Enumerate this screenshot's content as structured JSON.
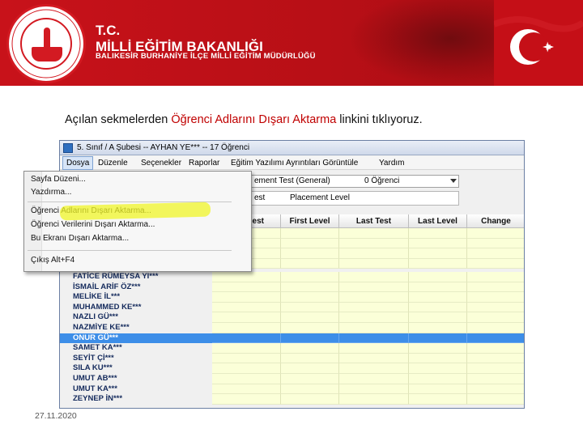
{
  "banner": {
    "title_line1": "T.C.",
    "title_line2": "MİLLİ EĞİTİM BAKANLIĞI",
    "subtitle": "BALIKESİR  BURHANİYE İLÇE MİLLİ EĞİTİM MÜDÜRLÜĞÜ",
    "seal_text": "T.C. MİLLİ EĞİTİM BAKANLIĞI",
    "colors": {
      "brand_red": "#c8121a"
    }
  },
  "instruction": {
    "before": "Açılan sekmelerden ",
    "link": "Öğrenci Adlarını Dışarı Aktarma",
    "after": " linkini tıklıyoruz."
  },
  "app": {
    "window_title": "5. Sınıf / A Şubesi -- AYHAN YE*** -- 17 Öğrenci",
    "menu": [
      "Dosya",
      "Düzenle",
      "Seçenekler",
      "Raporlar",
      "Eğitim Yazılımı Ayrıntıları Görüntüle",
      "Yardım"
    ],
    "combo": {
      "left": "ement Test (General)",
      "right": "0 Öğrenci"
    },
    "labels_row": {
      "left": "est",
      "right": "Placement Level"
    },
    "columns": [
      "est",
      "First Level",
      "Last Test",
      "Last Level",
      "Change"
    ],
    "file_menu": {
      "items": [
        "Sayfa Düzeni...",
        "Yazdırma...",
        "Öğrenci Adlarını Dışarı Aktarma...",
        "Öğrenci Verilerini Dışarı Aktarma...",
        "Bu Ekranı Dışarı Aktarma...",
        "Çıkış Alt+F4"
      ]
    },
    "students": [
      "FATİCE RÜMEYSA YI***",
      "İSMAİL ARİF ÖZ***",
      "MELİKE İL***",
      "MUHAMMED KE***",
      "NAZLI GÜ***",
      "NAZMİYE KE***",
      "ONUR GÜ***",
      "SAMET KA***",
      "SEYİT Çİ***",
      "SILA KU***",
      "UMUT AB***",
      "UMUT KA***",
      "ZEYNEP İN***"
    ],
    "selected_student": "ONUR GÜ***",
    "colors": {
      "selection": "#3d8ee8",
      "cell_fill": "#fbffd8",
      "highlight": "#f0f528"
    }
  },
  "footer": {
    "date": "27.11.2020"
  }
}
